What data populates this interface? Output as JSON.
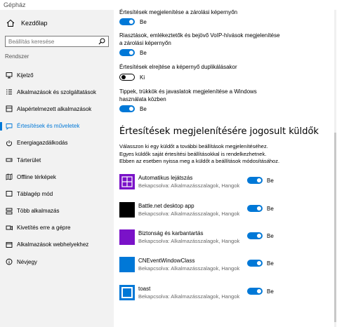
{
  "window": {
    "title": "Gépház"
  },
  "sidebar": {
    "home_label": "Kezdőlap",
    "search_placeholder": "Beállítás keresése",
    "section": "Rendszer",
    "items": [
      {
        "label": "Kijelző",
        "icon": "monitor-icon"
      },
      {
        "label": "Alkalmazások és szolgáltatások",
        "icon": "apps-list-icon"
      },
      {
        "label": "Alapértelmezett alkalmazások",
        "icon": "default-apps-icon"
      },
      {
        "label": "Értesítések és műveletek",
        "icon": "notification-icon",
        "active": true
      },
      {
        "label": "Energiagazdálkodás",
        "icon": "power-icon"
      },
      {
        "label": "Tárterület",
        "icon": "storage-icon"
      },
      {
        "label": "Offline térképek",
        "icon": "map-icon"
      },
      {
        "label": "Táblagép mód",
        "icon": "tablet-icon"
      },
      {
        "label": "Több alkalmazás",
        "icon": "multitasking-icon"
      },
      {
        "label": "Kivetítés erre a gépre",
        "icon": "project-icon"
      },
      {
        "label": "Alkalmazások webhelyekhez",
        "icon": "web-apps-icon"
      },
      {
        "label": "Névjegy",
        "icon": "info-icon"
      }
    ]
  },
  "options": [
    {
      "text": "Értesítések megjelenítése a zárolási képernyőn",
      "state": "Be"
    },
    {
      "text": "Riasztások, emlékeztetők és bejövő VoIP-hívások megjelenítése a zárolási képernyőn",
      "state": "Be"
    },
    {
      "text": "Értesítések elrejtése a képernyő duplikálásakor",
      "state": "Ki"
    },
    {
      "text": "Tippek, trükkök és javaslatok megjelenítése a Windows használata közben",
      "state": "Be"
    }
  ],
  "senders": {
    "heading": "Értesítések megjelenítésére jogosult küldők",
    "description": "Válasszon ki egy küldőt a további beállítások megjelenítéséhez. Egyes küldők saját értesítési beállításokkal is rendelkezhetnek. Ebben az esetben nyissa meg a küldőt a beállítások módosításához.",
    "apps": [
      {
        "name": "Automatikus lejátszás",
        "sub": "Bekapcsolva: Alkalmazásszalagok, Hangok",
        "state": "Be",
        "color": "#7a12c8"
      },
      {
        "name": "Battle.net desktop app",
        "sub": "Bekapcsolva: Alkalmazásszalagok, Hangok",
        "state": "Be",
        "color": "#000000"
      },
      {
        "name": "Biztonság és karbantartás",
        "sub": "Bekapcsolva: Alkalmazásszalagok, Hangok",
        "state": "Be",
        "color": "#7a12c8"
      },
      {
        "name": "CNEventWindowClass",
        "sub": "Bekapcsolva: Alkalmazásszalagok, Hangok",
        "state": "Be",
        "color": "#0078d7"
      },
      {
        "name": "toast",
        "sub": "Bekapcsolva: Alkalmazásszalagok, Hangok",
        "state": "Be",
        "color": "#0078d7"
      }
    ]
  }
}
